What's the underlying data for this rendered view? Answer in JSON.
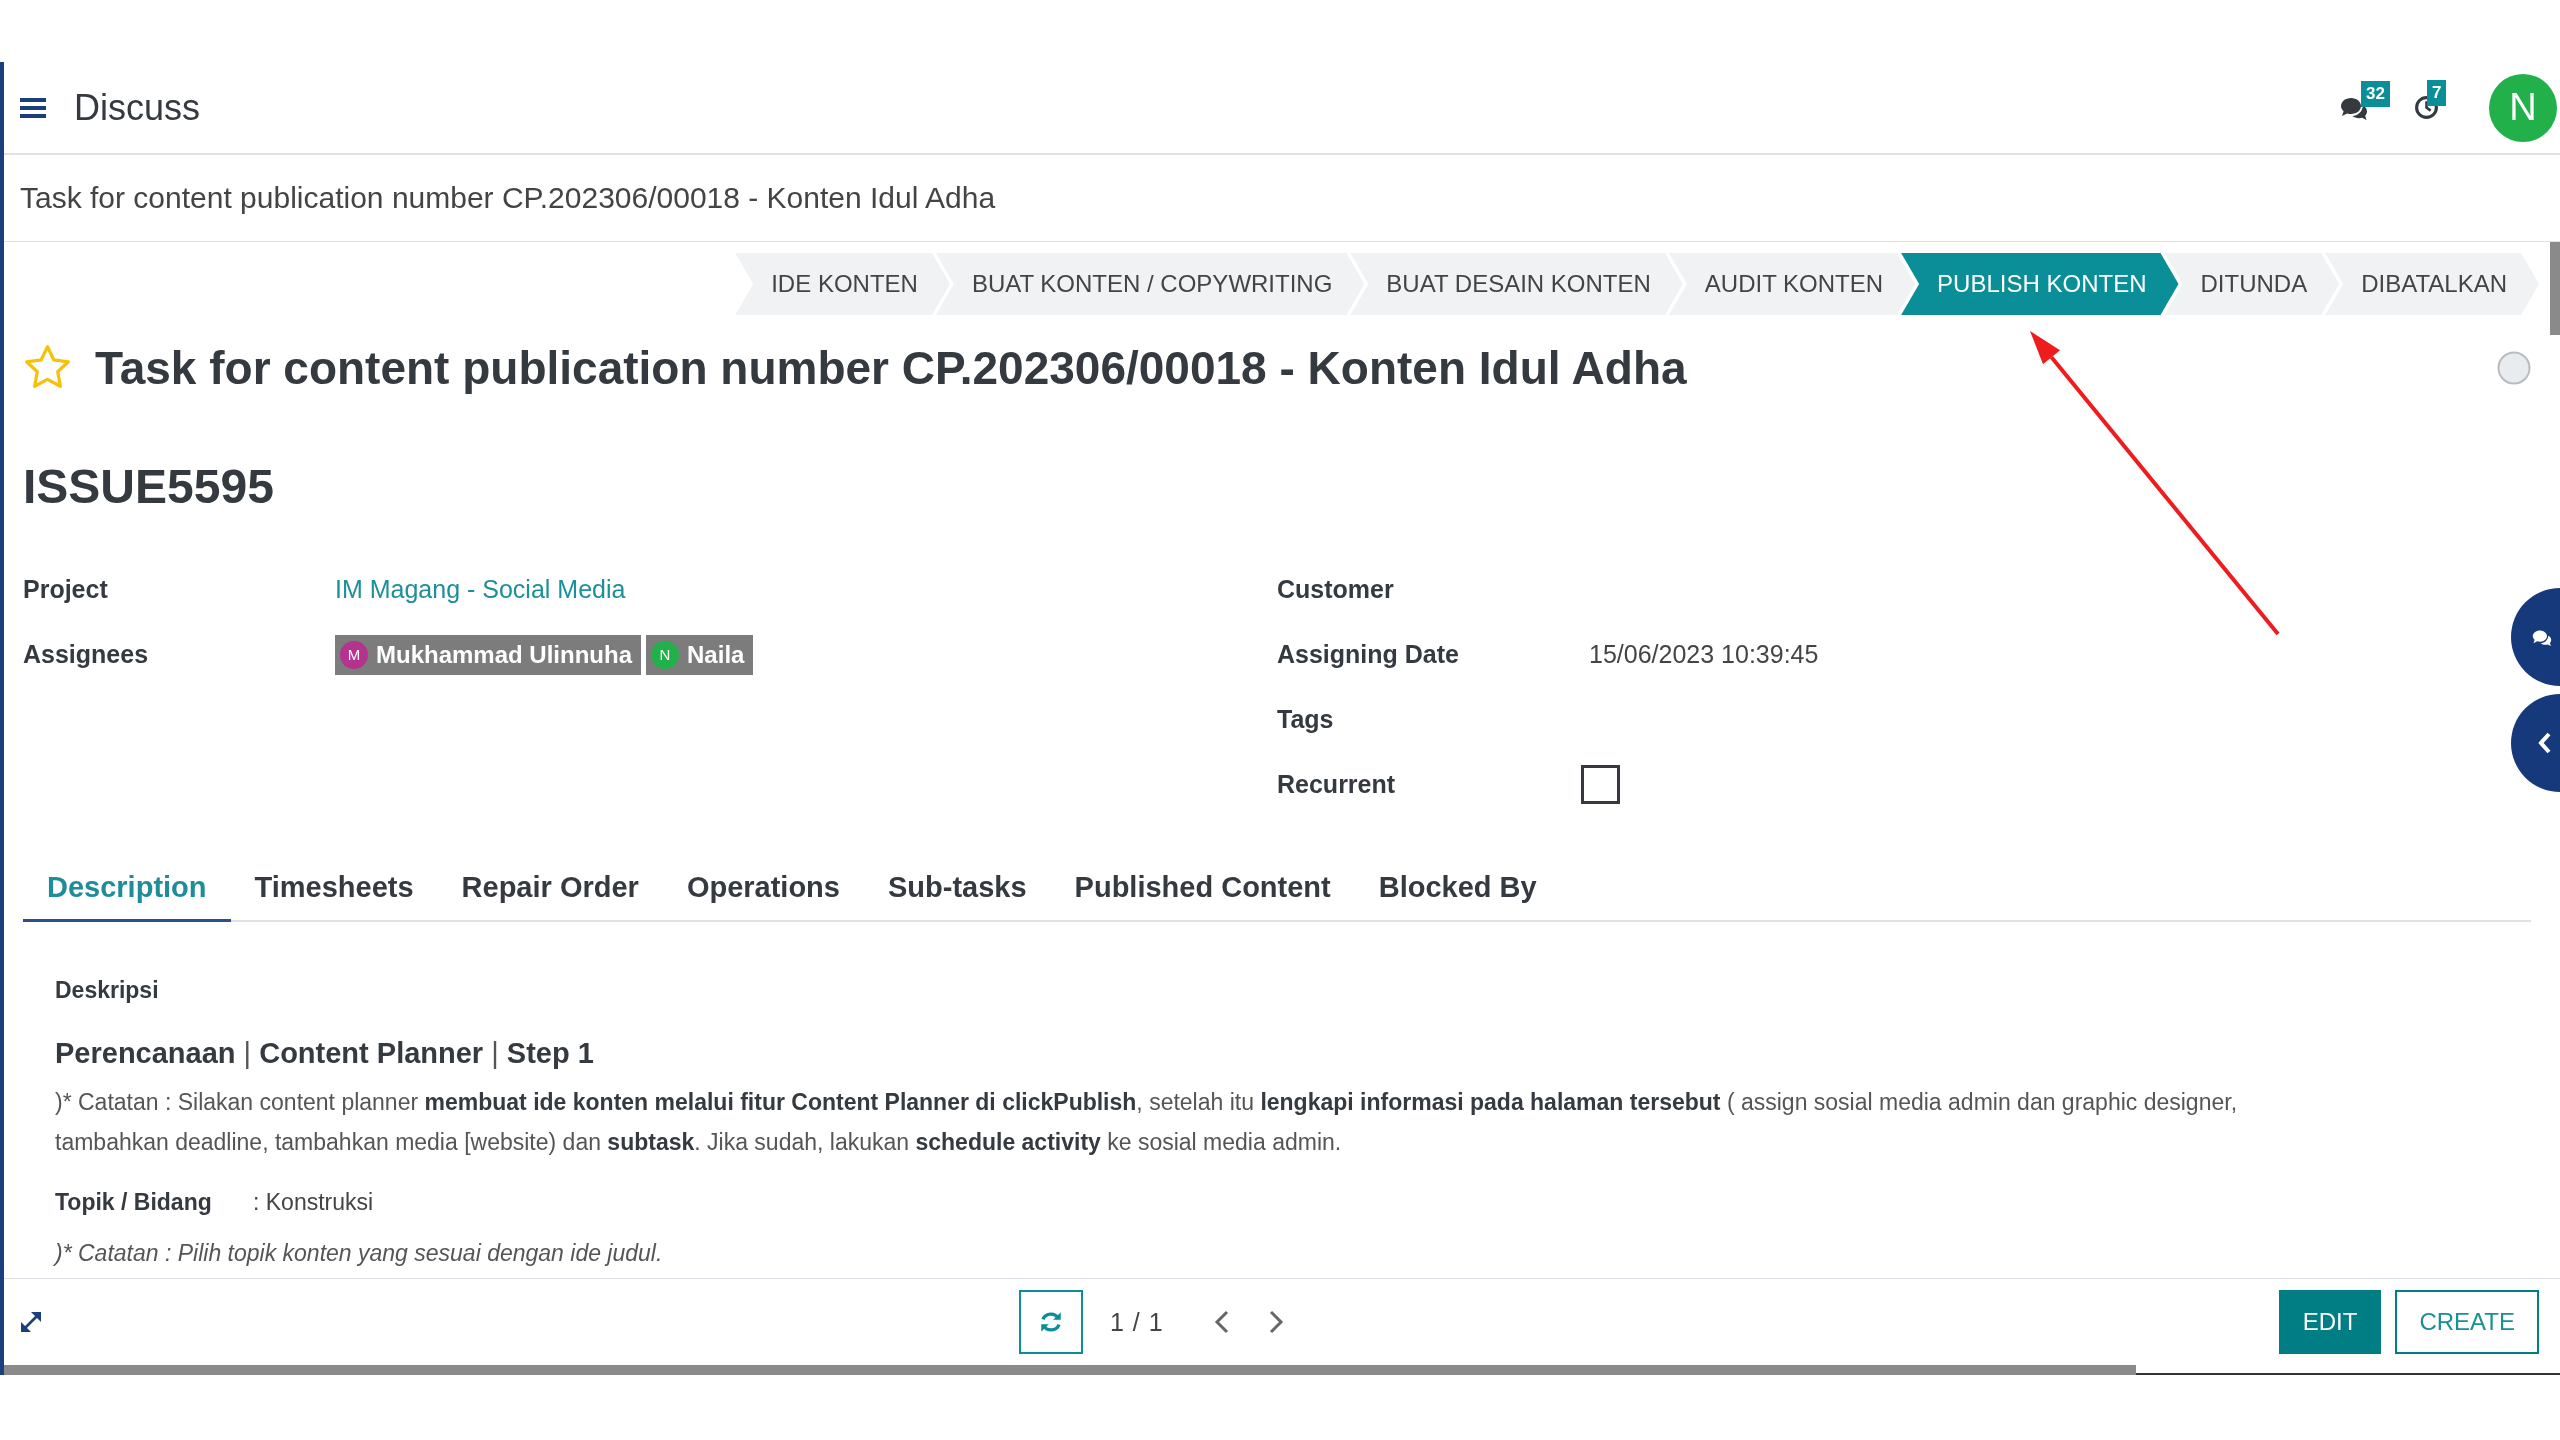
{
  "topbar": {
    "menu_title": "Discuss",
    "message_count": "32",
    "activity_count": "7",
    "user_initial": "N"
  },
  "breadcrumb": "Task for content publication number CP.202306/00018 - Konten Idul Adha",
  "stages": [
    {
      "label": "IDE KONTEN",
      "selected": false
    },
    {
      "label": "BUAT KONTEN / COPYWRITING",
      "selected": false
    },
    {
      "label": "BUAT DESAIN KONTEN",
      "selected": false
    },
    {
      "label": "AUDIT KONTEN",
      "selected": false
    },
    {
      "label": "PUBLISH KONTEN",
      "selected": true
    },
    {
      "label": "DITUNDA",
      "selected": false
    },
    {
      "label": "DIBATALKAN",
      "selected": false
    }
  ],
  "record": {
    "starred": false,
    "title": "Task for content publication number CP.202306/00018 - Konten Idul Adha",
    "reference": "ISSUE5595"
  },
  "fields_left": [
    {
      "label": "Project",
      "kind": "link",
      "value": "IM Magang - Social Media"
    },
    {
      "label": "Assignees",
      "kind": "tags",
      "tags": [
        {
          "initial": "M",
          "name": "Mukhammad Ulinnuha",
          "color": "#b5338f"
        },
        {
          "initial": "N",
          "name": "Naila",
          "color": "#22b04b"
        }
      ]
    }
  ],
  "fields_right": [
    {
      "label": "Customer",
      "kind": "text"
    },
    {
      "label": "Assigning Date",
      "kind": "text",
      "value": "15/06/2023 10:39:45"
    },
    {
      "label": "Tags",
      "kind": "text"
    },
    {
      "label": "Recurrent",
      "kind": "checkbox",
      "checked": false
    }
  ],
  "tabs": [
    {
      "label": "Description",
      "selected": true
    },
    {
      "label": "Timesheets",
      "selected": false
    },
    {
      "label": "Repair Order",
      "selected": false
    },
    {
      "label": "Operations",
      "selected": false
    },
    {
      "label": "Sub-tasks",
      "selected": false
    },
    {
      "label": "Published Content",
      "selected": false
    },
    {
      "label": "Blocked By",
      "selected": false
    }
  ],
  "description": {
    "section_label": "Deskripsi",
    "heading": "**Perencanaan** | **Content Planner** | **Step 1**",
    "note": ")* Catatan : Silakan content planner **membuat ide konten melalui fitur Content Planner di clickPublish**, setelah itu **lengkapi informasi pada halaman tersebut** ( assign sosial media admin dan graphic designer, tambahkan deadline, tambahkan media [website) dan **subtask**. Jika sudah, lakukan **schedule activity** ke sosial media admin.",
    "topic_label": "Topik / Bidang",
    "topic_value": ": Konstruksi",
    "topic_note": ")* Catatan : Pilih topik konten yang sesuai dengan ide judul."
  },
  "pager": "1 / 1",
  "buttons": [
    {
      "label": "EDIT",
      "kind": "primary"
    },
    {
      "label": "CREATE",
      "kind": "secondary"
    }
  ]
}
